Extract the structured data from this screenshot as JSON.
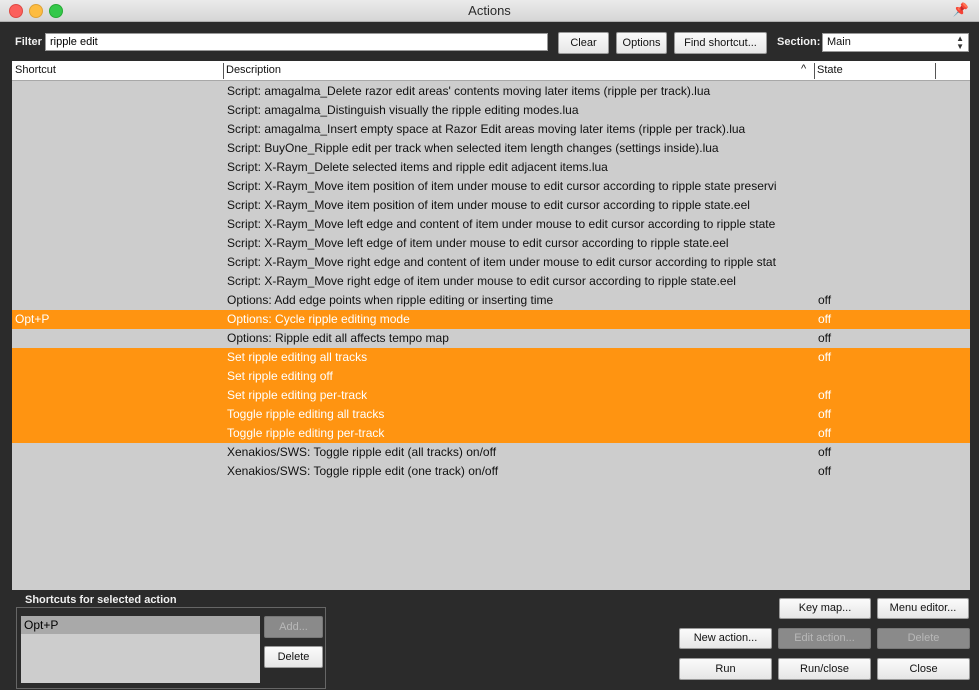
{
  "window": {
    "title": "Actions"
  },
  "toolbar": {
    "filter_label": "Filter",
    "filter_value": "ripple edit",
    "clear_label": "Clear",
    "options_label": "Options",
    "find_label": "Find shortcut...",
    "section_label": "Section:",
    "section_value": "Main"
  },
  "columns": {
    "shortcut": "Shortcut",
    "description": "Description",
    "state": "State"
  },
  "rows": [
    {
      "shortcut": "",
      "description": "Script: amagalma_Delete razor edit areas' contents moving later items (ripple per track).lua",
      "state": ""
    },
    {
      "shortcut": "",
      "description": "Script: amagalma_Distinguish visually the ripple editing modes.lua",
      "state": ""
    },
    {
      "shortcut": "",
      "description": "Script: amagalma_Insert empty space at Razor Edit areas moving later items (ripple per track).lua",
      "state": ""
    },
    {
      "shortcut": "",
      "description": "Script: BuyOne_Ripple edit per track when selected item length changes (settings inside).lua",
      "state": ""
    },
    {
      "shortcut": "",
      "description": "Script: X-Raym_Delete selected items and ripple edit adjacent items.lua",
      "state": ""
    },
    {
      "shortcut": "",
      "description": "Script: X-Raym_Move item position of item under mouse to edit cursor according to ripple state preservi",
      "state": ""
    },
    {
      "shortcut": "",
      "description": "Script: X-Raym_Move item position of item under mouse to edit cursor according to ripple state.eel",
      "state": ""
    },
    {
      "shortcut": "",
      "description": "Script: X-Raym_Move left edge and content of item under mouse to edit cursor according to ripple state",
      "state": ""
    },
    {
      "shortcut": "",
      "description": "Script: X-Raym_Move left edge of item under mouse to edit cursor according to ripple state.eel",
      "state": ""
    },
    {
      "shortcut": "",
      "description": "Script: X-Raym_Move right edge and content of item under mouse to edit cursor according to ripple stat",
      "state": ""
    },
    {
      "shortcut": "",
      "description": "Script: X-Raym_Move right edge of item under mouse to edit cursor according to ripple state.eel",
      "state": ""
    },
    {
      "shortcut": "",
      "description": "Options: Add edge points when ripple editing or inserting time",
      "state": "off"
    },
    {
      "shortcut": "Opt+P",
      "description": "Options: Cycle ripple editing mode",
      "state": "off",
      "selected": true
    },
    {
      "shortcut": "",
      "description": "Options: Ripple edit all affects tempo map",
      "state": "off"
    },
    {
      "shortcut": "",
      "description": "Set ripple editing all tracks",
      "state": "off",
      "selected": true
    },
    {
      "shortcut": "",
      "description": "Set ripple editing off",
      "state": "",
      "selected": true
    },
    {
      "shortcut": "",
      "description": "Set ripple editing per-track",
      "state": "off",
      "selected": true
    },
    {
      "shortcut": "",
      "description": "Toggle ripple editing all tracks",
      "state": "off",
      "selected": true
    },
    {
      "shortcut": "",
      "description": "Toggle ripple editing per-track",
      "state": "off",
      "selected": true
    },
    {
      "shortcut": "",
      "description": "Xenakios/SWS: Toggle ripple edit (all tracks) on/off",
      "state": "off"
    },
    {
      "shortcut": "",
      "description": "Xenakios/SWS: Toggle ripple edit (one track) on/off",
      "state": "off"
    }
  ],
  "shortcuts_panel": {
    "label": "Shortcuts for selected action",
    "items": [
      "Opt+P"
    ],
    "add_label": "Add...",
    "delete_label": "Delete"
  },
  "buttons": {
    "key_map": "Key map...",
    "menu_editor": "Menu editor...",
    "new_action": "New action...",
    "edit_action": "Edit action...",
    "delete": "Delete",
    "run": "Run",
    "run_close": "Run/close",
    "close": "Close"
  },
  "colors": {
    "selection": "#ff9411",
    "list_bg": "#cdcdcd",
    "window_bg": "#2b2b2b"
  }
}
